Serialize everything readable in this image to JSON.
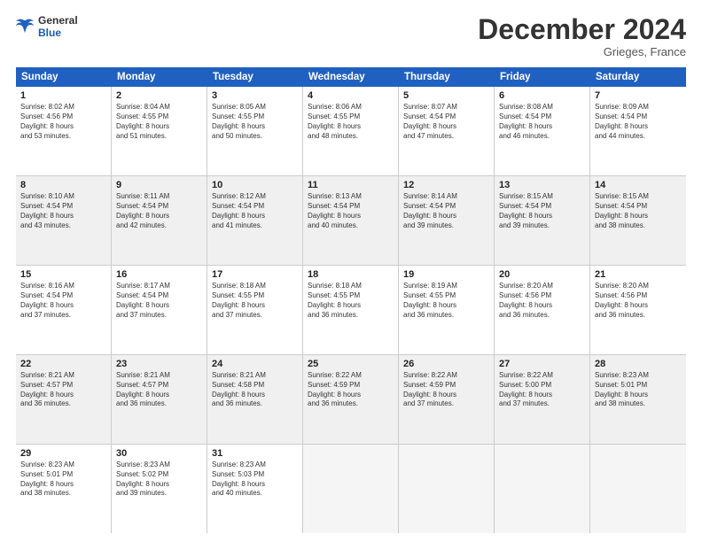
{
  "logo": {
    "line1": "General",
    "line2": "Blue"
  },
  "title": "December 2024",
  "subtitle": "Grieges, France",
  "header_days": [
    "Sunday",
    "Monday",
    "Tuesday",
    "Wednesday",
    "Thursday",
    "Friday",
    "Saturday"
  ],
  "weeks": [
    [
      {
        "day": "1",
        "lines": [
          "Sunrise: 8:02 AM",
          "Sunset: 4:56 PM",
          "Daylight: 8 hours",
          "and 53 minutes."
        ],
        "shaded": false,
        "empty": false
      },
      {
        "day": "2",
        "lines": [
          "Sunrise: 8:04 AM",
          "Sunset: 4:55 PM",
          "Daylight: 8 hours",
          "and 51 minutes."
        ],
        "shaded": false,
        "empty": false
      },
      {
        "day": "3",
        "lines": [
          "Sunrise: 8:05 AM",
          "Sunset: 4:55 PM",
          "Daylight: 8 hours",
          "and 50 minutes."
        ],
        "shaded": false,
        "empty": false
      },
      {
        "day": "4",
        "lines": [
          "Sunrise: 8:06 AM",
          "Sunset: 4:55 PM",
          "Daylight: 8 hours",
          "and 48 minutes."
        ],
        "shaded": false,
        "empty": false
      },
      {
        "day": "5",
        "lines": [
          "Sunrise: 8:07 AM",
          "Sunset: 4:54 PM",
          "Daylight: 8 hours",
          "and 47 minutes."
        ],
        "shaded": false,
        "empty": false
      },
      {
        "day": "6",
        "lines": [
          "Sunrise: 8:08 AM",
          "Sunset: 4:54 PM",
          "Daylight: 8 hours",
          "and 46 minutes."
        ],
        "shaded": false,
        "empty": false
      },
      {
        "day": "7",
        "lines": [
          "Sunrise: 8:09 AM",
          "Sunset: 4:54 PM",
          "Daylight: 8 hours",
          "and 44 minutes."
        ],
        "shaded": false,
        "empty": false
      }
    ],
    [
      {
        "day": "8",
        "lines": [
          "Sunrise: 8:10 AM",
          "Sunset: 4:54 PM",
          "Daylight: 8 hours",
          "and 43 minutes."
        ],
        "shaded": true,
        "empty": false
      },
      {
        "day": "9",
        "lines": [
          "Sunrise: 8:11 AM",
          "Sunset: 4:54 PM",
          "Daylight: 8 hours",
          "and 42 minutes."
        ],
        "shaded": true,
        "empty": false
      },
      {
        "day": "10",
        "lines": [
          "Sunrise: 8:12 AM",
          "Sunset: 4:54 PM",
          "Daylight: 8 hours",
          "and 41 minutes."
        ],
        "shaded": true,
        "empty": false
      },
      {
        "day": "11",
        "lines": [
          "Sunrise: 8:13 AM",
          "Sunset: 4:54 PM",
          "Daylight: 8 hours",
          "and 40 minutes."
        ],
        "shaded": true,
        "empty": false
      },
      {
        "day": "12",
        "lines": [
          "Sunrise: 8:14 AM",
          "Sunset: 4:54 PM",
          "Daylight: 8 hours",
          "and 39 minutes."
        ],
        "shaded": true,
        "empty": false
      },
      {
        "day": "13",
        "lines": [
          "Sunrise: 8:15 AM",
          "Sunset: 4:54 PM",
          "Daylight: 8 hours",
          "and 39 minutes."
        ],
        "shaded": true,
        "empty": false
      },
      {
        "day": "14",
        "lines": [
          "Sunrise: 8:15 AM",
          "Sunset: 4:54 PM",
          "Daylight: 8 hours",
          "and 38 minutes."
        ],
        "shaded": true,
        "empty": false
      }
    ],
    [
      {
        "day": "15",
        "lines": [
          "Sunrise: 8:16 AM",
          "Sunset: 4:54 PM",
          "Daylight: 8 hours",
          "and 37 minutes."
        ],
        "shaded": false,
        "empty": false
      },
      {
        "day": "16",
        "lines": [
          "Sunrise: 8:17 AM",
          "Sunset: 4:54 PM",
          "Daylight: 8 hours",
          "and 37 minutes."
        ],
        "shaded": false,
        "empty": false
      },
      {
        "day": "17",
        "lines": [
          "Sunrise: 8:18 AM",
          "Sunset: 4:55 PM",
          "Daylight: 8 hours",
          "and 37 minutes."
        ],
        "shaded": false,
        "empty": false
      },
      {
        "day": "18",
        "lines": [
          "Sunrise: 8:18 AM",
          "Sunset: 4:55 PM",
          "Daylight: 8 hours",
          "and 36 minutes."
        ],
        "shaded": false,
        "empty": false
      },
      {
        "day": "19",
        "lines": [
          "Sunrise: 8:19 AM",
          "Sunset: 4:55 PM",
          "Daylight: 8 hours",
          "and 36 minutes."
        ],
        "shaded": false,
        "empty": false
      },
      {
        "day": "20",
        "lines": [
          "Sunrise: 8:20 AM",
          "Sunset: 4:56 PM",
          "Daylight: 8 hours",
          "and 36 minutes."
        ],
        "shaded": false,
        "empty": false
      },
      {
        "day": "21",
        "lines": [
          "Sunrise: 8:20 AM",
          "Sunset: 4:56 PM",
          "Daylight: 8 hours",
          "and 36 minutes."
        ],
        "shaded": false,
        "empty": false
      }
    ],
    [
      {
        "day": "22",
        "lines": [
          "Sunrise: 8:21 AM",
          "Sunset: 4:57 PM",
          "Daylight: 8 hours",
          "and 36 minutes."
        ],
        "shaded": true,
        "empty": false
      },
      {
        "day": "23",
        "lines": [
          "Sunrise: 8:21 AM",
          "Sunset: 4:57 PM",
          "Daylight: 8 hours",
          "and 36 minutes."
        ],
        "shaded": true,
        "empty": false
      },
      {
        "day": "24",
        "lines": [
          "Sunrise: 8:21 AM",
          "Sunset: 4:58 PM",
          "Daylight: 8 hours",
          "and 36 minutes."
        ],
        "shaded": true,
        "empty": false
      },
      {
        "day": "25",
        "lines": [
          "Sunrise: 8:22 AM",
          "Sunset: 4:59 PM",
          "Daylight: 8 hours",
          "and 36 minutes."
        ],
        "shaded": true,
        "empty": false
      },
      {
        "day": "26",
        "lines": [
          "Sunrise: 8:22 AM",
          "Sunset: 4:59 PM",
          "Daylight: 8 hours",
          "and 37 minutes."
        ],
        "shaded": true,
        "empty": false
      },
      {
        "day": "27",
        "lines": [
          "Sunrise: 8:22 AM",
          "Sunset: 5:00 PM",
          "Daylight: 8 hours",
          "and 37 minutes."
        ],
        "shaded": true,
        "empty": false
      },
      {
        "day": "28",
        "lines": [
          "Sunrise: 8:23 AM",
          "Sunset: 5:01 PM",
          "Daylight: 8 hours",
          "and 38 minutes."
        ],
        "shaded": true,
        "empty": false
      }
    ],
    [
      {
        "day": "29",
        "lines": [
          "Sunrise: 8:23 AM",
          "Sunset: 5:01 PM",
          "Daylight: 8 hours",
          "and 38 minutes."
        ],
        "shaded": false,
        "empty": false
      },
      {
        "day": "30",
        "lines": [
          "Sunrise: 8:23 AM",
          "Sunset: 5:02 PM",
          "Daylight: 8 hours",
          "and 39 minutes."
        ],
        "shaded": false,
        "empty": false
      },
      {
        "day": "31",
        "lines": [
          "Sunrise: 8:23 AM",
          "Sunset: 5:03 PM",
          "Daylight: 8 hours",
          "and 40 minutes."
        ],
        "shaded": false,
        "empty": false
      },
      {
        "day": "",
        "lines": [],
        "shaded": false,
        "empty": true
      },
      {
        "day": "",
        "lines": [],
        "shaded": false,
        "empty": true
      },
      {
        "day": "",
        "lines": [],
        "shaded": false,
        "empty": true
      },
      {
        "day": "",
        "lines": [],
        "shaded": false,
        "empty": true
      }
    ]
  ]
}
